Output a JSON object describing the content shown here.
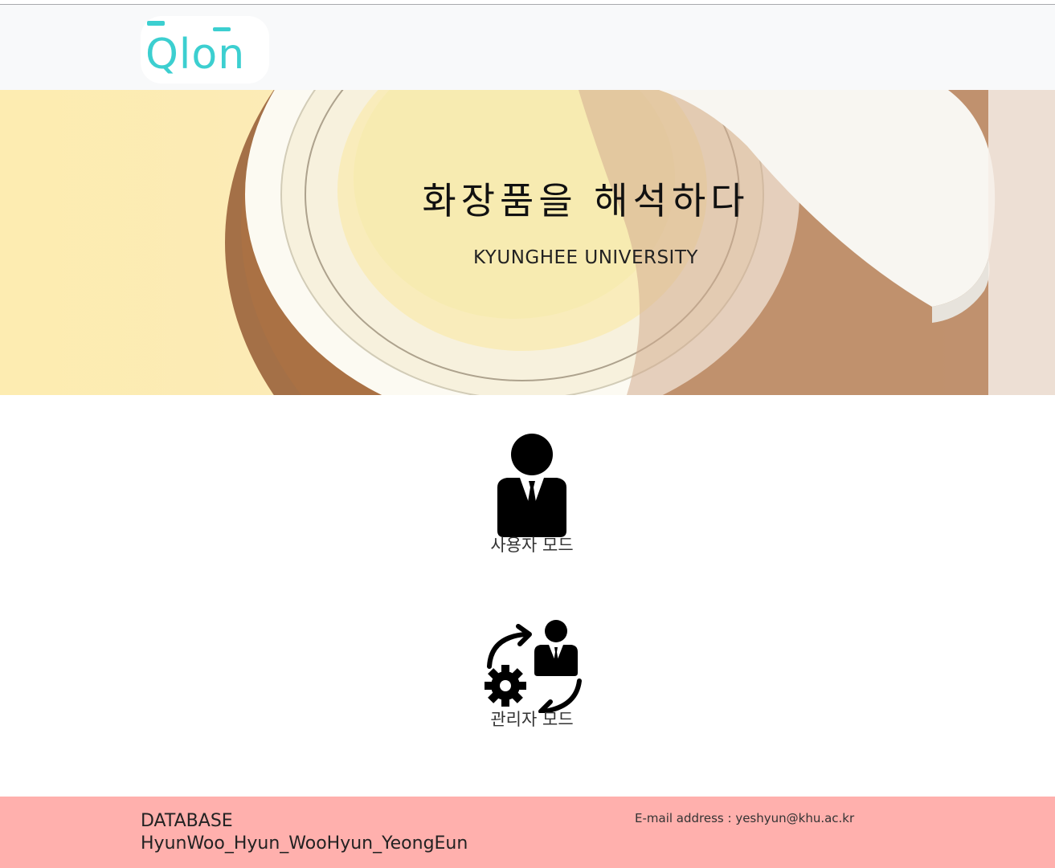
{
  "header": {
    "logo_text": "Qlon",
    "logo_color": "#3ccfd0"
  },
  "hero": {
    "title": "화장품을 해석하다",
    "subtitle": "KYUNGHEE UNIVERSITY"
  },
  "modes": [
    {
      "label": "사용자 모드",
      "icon": "businessman-icon"
    },
    {
      "label": "관리자 모드",
      "icon": "admin-gear-cycle-icon"
    }
  ],
  "footer": {
    "title": "DATABASE",
    "names": "HyunWoo_Hyun_WooHyun_YeongEun",
    "email": "E-mail address : yeshyun@khu.ac.kr",
    "background": "#ffb0ad"
  }
}
